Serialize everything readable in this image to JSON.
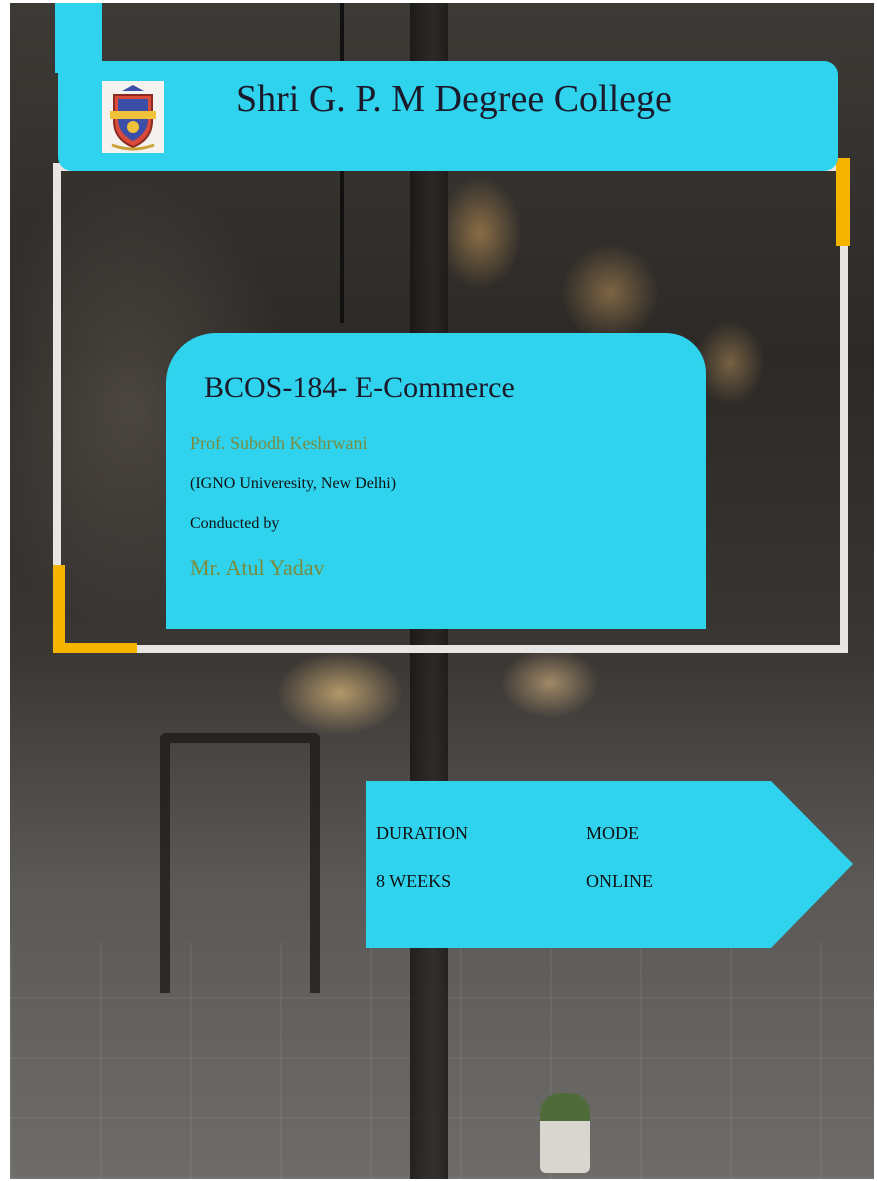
{
  "header": {
    "college_name": "Shri G. P. M Degree College",
    "logo_icon": "college-crest-icon"
  },
  "course": {
    "title": "BCOS-184- E-Commerce",
    "professor": "Prof. Subodh Keshrwani",
    "university": "(IGNO Univeresity, New Delhi)",
    "conducted_label": "Conducted by",
    "instructor": "Mr. Atul Yadav"
  },
  "info": {
    "duration_label": "DURATION",
    "duration_value": "8 WEEKS",
    "mode_label": "MODE",
    "mode_value": "ONLINE"
  },
  "colors": {
    "accent_cyan": "#2fd3ee",
    "accent_yellow": "#f5b400",
    "frame_white": "#e8e6e4",
    "name_olive": "#7b8a3c"
  }
}
